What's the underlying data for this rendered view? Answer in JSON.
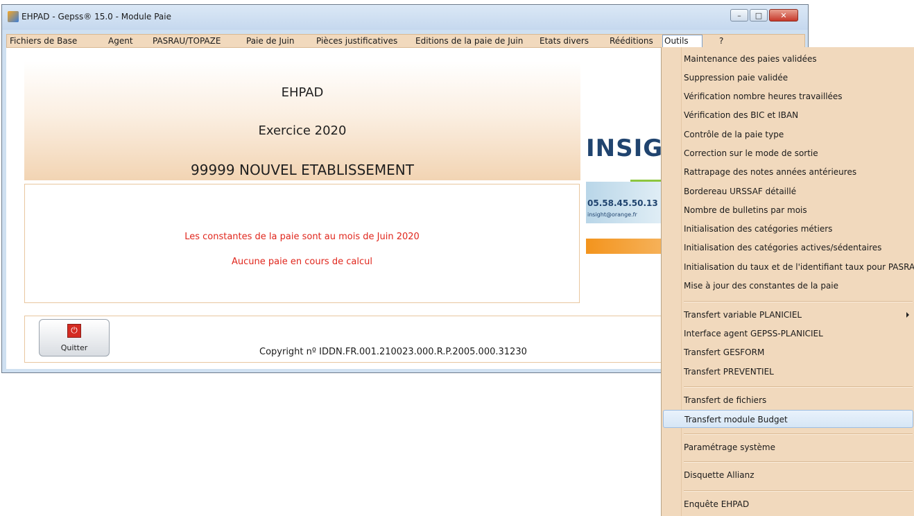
{
  "window": {
    "title": "EHPAD - Gepss® 15.0 - Module Paie",
    "controls": {
      "minimize": "–",
      "maximize": "□",
      "close": "✕"
    }
  },
  "menubar": {
    "items": [
      {
        "label": "Fichiers de Base"
      },
      {
        "label": "Agent"
      },
      {
        "label": "PASRAU/TOPAZE"
      },
      {
        "label": "Paie de Juin"
      },
      {
        "label": "Pièces justificatives"
      },
      {
        "label": "Editions de la paie de Juin"
      },
      {
        "label": "Etats divers"
      },
      {
        "label": "Rééditions"
      },
      {
        "label": "Outils"
      },
      {
        "label": "?"
      }
    ]
  },
  "banner": {
    "line1": "EHPAD",
    "line2": "Exercice   2020",
    "line3": "99999   NOUVEL ETABLISSEMENT"
  },
  "status": {
    "line1": "Les constantes de la paie sont au mois de Juin 2020",
    "line2": "Aucune paie en cours de calcul"
  },
  "footer": {
    "quit_label": "Quitter",
    "copyright": "Copyright nº IDDN.FR.001.210023.000.R.P.2005.000.31230"
  },
  "logo": {
    "text": "INSIG",
    "phone": "05.58.45.50.13",
    "email": "insight@orange.fr"
  },
  "outils_menu": {
    "items": [
      {
        "label": "Maintenance des paies validées"
      },
      {
        "label": "Suppression paie validée"
      },
      {
        "label": "Vérification nombre heures travaillées"
      },
      {
        "label": "Vérification des BIC et IBAN"
      },
      {
        "label": "Contrôle de la paie type"
      },
      {
        "label": "Correction sur le mode de sortie"
      },
      {
        "label": "Rattrapage des notes années antérieures"
      },
      {
        "label": "Bordereau URSSAF détaillé"
      },
      {
        "label": "Nombre de bulletins par mois"
      },
      {
        "label": "Initialisation des catégories métiers"
      },
      {
        "label": "Initialisation des catégories actives/sédentaires"
      },
      {
        "label": "Initialisation du taux et de l'identifiant taux pour PASRAU"
      },
      {
        "label": "Mise à jour des constantes de la paie"
      },
      {
        "label": "Transfert variable PLANICIEL"
      },
      {
        "label": "Interface agent GEPSS-PLANICIEL"
      },
      {
        "label": "Transfert GESFORM"
      },
      {
        "label": "Transfert PREVENTIEL"
      },
      {
        "label": "Transfert de fichiers"
      },
      {
        "label": "Transfert module Budget"
      },
      {
        "label": "Paramétrage système"
      },
      {
        "label": "Disquette Allianz"
      },
      {
        "label": "Enquête EHPAD"
      }
    ],
    "highlighted": "Transfert module Budget"
  }
}
